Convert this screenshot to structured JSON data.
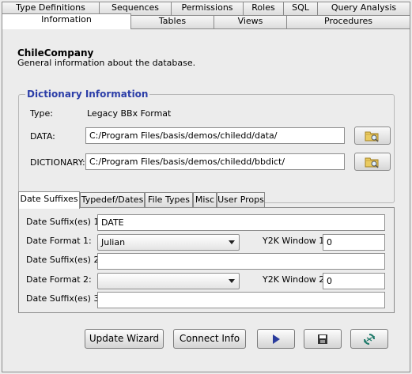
{
  "tabs_row1": [
    "Type Definitions",
    "Sequences",
    "Permissions",
    "Roles",
    "SQL",
    "Query Analysis"
  ],
  "tabs_row2": [
    "Information",
    "Tables",
    "Views",
    "Procedures"
  ],
  "active_tab": "Information",
  "header": {
    "title": "ChileCompany",
    "subtitle": "General information about the database."
  },
  "dictionary": {
    "group_title": "Dictionary Information",
    "type_label": "Type:",
    "type_value": "Legacy BBx Format",
    "data_label": "DATA:",
    "data_value": "C:/Program Files/basis/demos/chiledd/data/",
    "dictionary_label": "DICTIONARY:",
    "dictionary_value": "C:/Program Files/basis/demos/chiledd/bbdict/"
  },
  "subtabs": [
    "Date Suffixes",
    "Typedef/Dates",
    "File Types",
    "Misc",
    "User Props"
  ],
  "active_subtab": "Date Suffixes",
  "date_suffixes": {
    "suffix1_label": "Date Suffix(es) 1:",
    "suffix1_value": "DATE",
    "format1_label": "Date Format 1:",
    "format1_value": "Julian",
    "y2k1_label": "Y2K Window 1:",
    "y2k1_value": "0",
    "suffix2_label": "Date Suffix(es) 2:",
    "suffix2_value": "",
    "format2_label": "Date Format 2:",
    "format2_value": "",
    "y2k2_label": "Y2K Window 2:",
    "y2k2_value": "0",
    "suffix3_label": "Date Suffix(es) 3:",
    "suffix3_value": ""
  },
  "buttons": {
    "update_wizard": "Update Wizard",
    "connect_info": "Connect Info"
  },
  "colors": {
    "group_title": "#2c3ea8",
    "play_icon": "#2a3b9c",
    "folder_icon": "#e9c75a"
  }
}
